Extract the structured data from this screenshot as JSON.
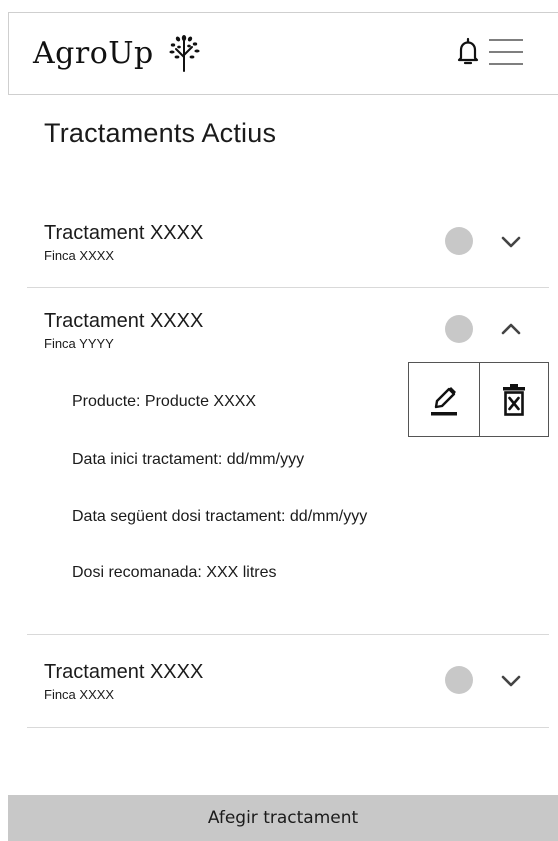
{
  "header": {
    "logo_text": "AgroUp",
    "logo_icon": "tree-icon",
    "notification_icon": "bell-icon",
    "menu_icon": "hamburger-menu-icon"
  },
  "page": {
    "title": "Tractaments Actius"
  },
  "treatments": [
    {
      "title": "Tractament XXXX",
      "subtitle": "Finca XXXX",
      "expanded": false
    },
    {
      "title": "Tractament XXXX",
      "subtitle": "Finca YYYY",
      "expanded": true,
      "details": {
        "product": "Producte: Producte XXXX",
        "start_date": "Data inici tractament: dd/mm/yyy",
        "next_dose_date": "Data següent dosi tractament: dd/mm/yyy",
        "recommended_dose": "Dosi recomanada: XXX litres"
      },
      "actions": {
        "edit_icon": "pencil-icon",
        "delete_icon": "trash-icon"
      }
    },
    {
      "title": "Tractament XXXX",
      "subtitle": "Finca XXXX",
      "expanded": false
    }
  ],
  "footer": {
    "add_button_label": "Afegir tractament"
  },
  "colors": {
    "status_dot": "#c8c8c8",
    "add_button_bg": "#c8c8c8",
    "divider": "#d9d9d9",
    "text": "#1b1b1b"
  }
}
